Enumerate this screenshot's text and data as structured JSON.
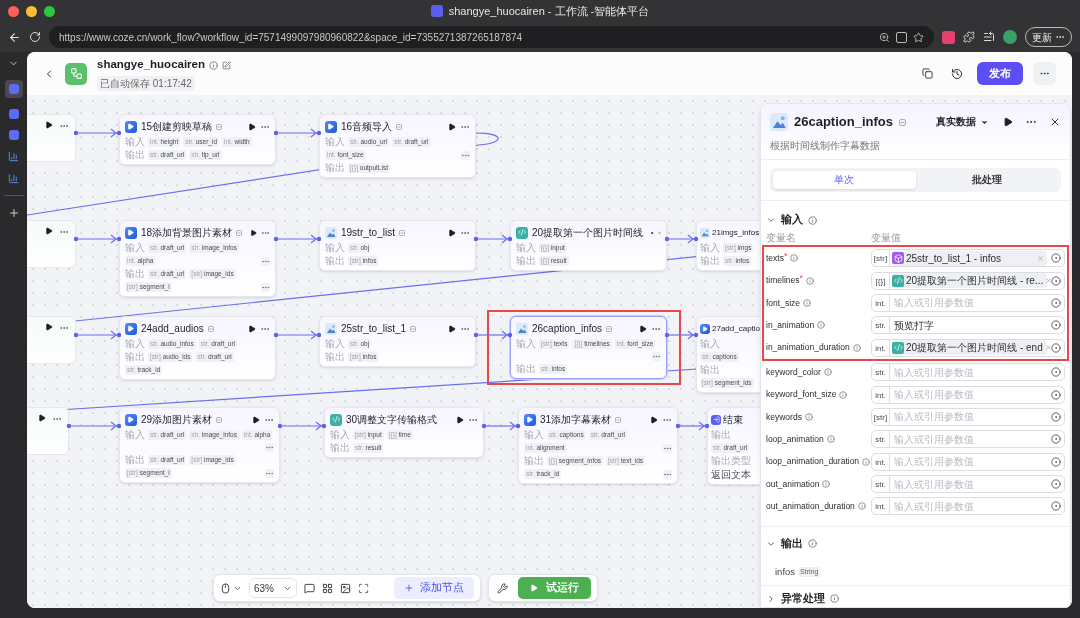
{
  "browser": {
    "tab_title": "shangye_huocairen - 工作流 -智能体平台",
    "url": "https://www.coze.cn/work_flow?workflow_id=7571499097980960822&space_id=7355271387265187874",
    "update_button": "更新"
  },
  "header": {
    "title": "shangye_huocairen",
    "autosave": "已自动保存 01:17:42",
    "publish_button": "发布"
  },
  "nodes": [
    {
      "title": "15创建剪映草稿",
      "kind": "clip",
      "plugin_mark": true,
      "selected": false,
      "highlighted": false,
      "rows": [
        {
          "label": "输入",
          "pins": [
            {
              "type": "int.",
              "name": "height"
            },
            {
              "type": "str.",
              "name": "user_id"
            },
            {
              "type": "int.",
              "name": "width"
            }
          ],
          "more": false
        },
        {
          "label": "输出",
          "pins": [
            {
              "type": "str.",
              "name": "draft_url"
            },
            {
              "type": "str.",
              "name": "tip_url"
            }
          ],
          "more": false
        }
      ]
    },
    {
      "title": "16音频导入",
      "kind": "clip",
      "plugin_mark": true,
      "selected": false,
      "highlighted": false,
      "rows": [
        {
          "label": "输入",
          "pins": [
            {
              "type": "str.",
              "name": "audio_url"
            },
            {
              "type": "str.",
              "name": "draft_url"
            },
            {
              "type": "int.",
              "name": "font_size"
            }
          ],
          "more": true
        },
        {
          "label": "输出",
          "pins": [
            {
              "type": "[{}]",
              "name": "outputList"
            }
          ],
          "more": false
        }
      ]
    },
    {
      "title": "18添加背景图片素材",
      "kind": "clip",
      "plugin_mark": true,
      "selected": false,
      "highlighted": false,
      "rows": [
        {
          "label": "输入",
          "pins": [
            {
              "type": "str.",
              "name": "draft_url"
            },
            {
              "type": "str.",
              "name": "image_infos"
            },
            {
              "type": "int.",
              "name": "alpha"
            }
          ],
          "more": true
        },
        {
          "label": "输出",
          "pins": [
            {
              "type": "str.",
              "name": "draft_url"
            },
            {
              "type": "[str]",
              "name": "image_ids"
            },
            {
              "type": "[str]",
              "name": "segment_i"
            }
          ],
          "more": true
        }
      ]
    },
    {
      "title": "19str_to_list",
      "kind": "picture",
      "plugin_mark": true,
      "selected": false,
      "highlighted": false,
      "rows": [
        {
          "label": "输入",
          "pins": [
            {
              "type": "str.",
              "name": "obj"
            }
          ],
          "more": false
        },
        {
          "label": "输出",
          "pins": [
            {
              "type": "[str]",
              "name": "infos"
            }
          ],
          "more": false
        }
      ]
    },
    {
      "title": "20提取第一个图片时间线",
      "kind": "code",
      "plugin_mark": false,
      "selected": false,
      "highlighted": false,
      "rows": [
        {
          "label": "输入",
          "pins": [
            {
              "type": "[{}]",
              "name": "input"
            }
          ],
          "more": false
        },
        {
          "label": "输出",
          "pins": [
            {
              "type": "[{}]",
              "name": "result"
            }
          ],
          "more": false
        }
      ]
    },
    {
      "title": "21imgs_infos",
      "kind": "picture",
      "plugin_mark": false,
      "selected": false,
      "highlighted": false,
      "rows": [
        {
          "label": "输入",
          "pins": [
            {
              "type": "[str]",
              "name": "imgs"
            }
          ],
          "more": false
        },
        {
          "label": "输出",
          "pins": [
            {
              "type": "str.",
              "name": "infos"
            }
          ],
          "more": false
        }
      ]
    },
    {
      "title": "24add_audios",
      "kind": "clip",
      "plugin_mark": true,
      "selected": false,
      "highlighted": false,
      "rows": [
        {
          "label": "输入",
          "pins": [
            {
              "type": "str.",
              "name": "audio_infos"
            },
            {
              "type": "str.",
              "name": "draft_url"
            }
          ],
          "more": false
        },
        {
          "label": "输出",
          "pins": [
            {
              "type": "[str]",
              "name": "audio_ids"
            },
            {
              "type": "str.",
              "name": "draft_url"
            },
            {
              "type": "str.",
              "name": "track_id"
            }
          ],
          "more": false
        }
      ]
    },
    {
      "title": "25str_to_list_1",
      "kind": "picture",
      "plugin_mark": true,
      "selected": false,
      "highlighted": false,
      "rows": [
        {
          "label": "输入",
          "pins": [
            {
              "type": "str.",
              "name": "obj"
            }
          ],
          "more": false
        },
        {
          "label": "输出",
          "pins": [
            {
              "type": "[str]",
              "name": "infos"
            }
          ],
          "more": false
        }
      ]
    },
    {
      "title": "26caption_infos",
      "kind": "picture",
      "plugin_mark": true,
      "selected": true,
      "highlighted": true,
      "rows": [
        {
          "label": "输入",
          "pins": [
            {
              "type": "[str]",
              "name": "texts"
            },
            {
              "type": "[{}]",
              "name": "timelines"
            },
            {
              "type": "int.",
              "name": "font_size"
            }
          ],
          "more": true
        },
        {
          "label": "输出",
          "pins": [
            {
              "type": "str.",
              "name": "infos"
            }
          ],
          "more": false
        }
      ]
    },
    {
      "title": "27add_captio",
      "kind": "clip",
      "plugin_mark": false,
      "selected": false,
      "highlighted": false,
      "rows": [
        {
          "label": "输入",
          "pins": [
            {
              "type": "str.",
              "name": "captions"
            }
          ],
          "more": false
        },
        {
          "label": "输出",
          "pins": [
            {
              "type": "[str]",
              "name": "segment_ids"
            }
          ],
          "more": false
        }
      ]
    },
    {
      "title": "29添加图片素材",
      "kind": "clip",
      "plugin_mark": true,
      "selected": false,
      "highlighted": false,
      "rows": [
        {
          "label": "输入",
          "pins": [
            {
              "type": "str.",
              "name": "draft_url"
            },
            {
              "type": "str.",
              "name": "image_infos"
            },
            {
              "type": "int.",
              "name": "alpha"
            }
          ],
          "more": true
        },
        {
          "label": "输出",
          "pins": [
            {
              "type": "str.",
              "name": "draft_url"
            },
            {
              "type": "[str]",
              "name": "image_ids"
            },
            {
              "type": "[str]",
              "name": "segment_i"
            }
          ],
          "more": true
        }
      ]
    },
    {
      "title": "30调整文字传输格式",
      "kind": "code",
      "plugin_mark": false,
      "selected": false,
      "highlighted": false,
      "rows": [
        {
          "label": "输入",
          "pins": [
            {
              "type": "[str]",
              "name": "input"
            },
            {
              "type": "[{}]",
              "name": "time"
            }
          ],
          "more": false
        },
        {
          "label": "输出",
          "pins": [
            {
              "type": "str.",
              "name": "result"
            }
          ],
          "more": false
        }
      ]
    },
    {
      "title": "31添加字幕素材",
      "kind": "clip",
      "plugin_mark": true,
      "selected": false,
      "highlighted": false,
      "rows": [
        {
          "label": "输入",
          "pins": [
            {
              "type": "str.",
              "name": "captions"
            },
            {
              "type": "str.",
              "name": "draft_url"
            },
            {
              "type": "int.",
              "name": "alignment"
            }
          ],
          "more": true
        },
        {
          "label": "输出",
          "pins": [
            {
              "type": "[{}]",
              "name": "segment_infos"
            },
            {
              "type": "[str]",
              "name": "text_ids"
            },
            {
              "type": "str.",
              "name": "track_id"
            }
          ],
          "more": true
        }
      ]
    },
    {
      "title": "结束",
      "kind": "end",
      "plugin_mark": false,
      "selected": false,
      "highlighted": false,
      "rows": [
        {
          "label": "输出",
          "pins": [
            {
              "type": "str.",
              "name": "draft_url"
            }
          ],
          "more": false
        },
        {
          "label": "输出类型",
          "value": "返回文本",
          "more": false
        }
      ]
    }
  ],
  "toolbar": {
    "zoom": "63%",
    "add_node_button": "添加节点",
    "run_button": "试运行"
  },
  "panel": {
    "title": "26caption_infos",
    "data_mode": "真实数据",
    "description": "根据时间线制作字幕数据",
    "tabs": [
      {
        "label": "单次",
        "selected": true
      },
      {
        "label": "批处理",
        "selected": false
      }
    ],
    "input_section": {
      "title": "输入",
      "expanded": true,
      "name_header": "变量名",
      "value_header": "变量值",
      "highlighted_params": [
        {
          "name": "texts",
          "required_mark": "*",
          "type": "[str]",
          "kind": "plugin_reference",
          "value": "25str_to_list_1 - infos"
        },
        {
          "name": "timelines",
          "required_mark": "*",
          "type": "[{}]",
          "kind": "code_reference",
          "value": "20提取第一个图片时间线 - re..."
        },
        {
          "name": "font_size",
          "type": "int.",
          "kind": "empty",
          "placeholder": "输入或引用参数值"
        },
        {
          "name": "in_animation",
          "type": "str.",
          "kind": "text",
          "value": "预览打字"
        },
        {
          "name": "in_animation_duration",
          "type": "int.",
          "kind": "code_reference",
          "value": "20提取第一个图片时间线 - end"
        }
      ],
      "params": [
        {
          "name": "keyword_color",
          "type": "str.",
          "kind": "empty",
          "placeholder": "输入或引用参数值"
        },
        {
          "name": "keyword_font_size",
          "type": "int.",
          "kind": "empty",
          "placeholder": "输入或引用参数值"
        },
        {
          "name": "keywords",
          "type": "[str]",
          "kind": "empty",
          "placeholder": "输入或引用参数值"
        },
        {
          "name": "loop_animation",
          "type": "str.",
          "kind": "empty",
          "placeholder": "输入或引用参数值"
        },
        {
          "name": "loop_animation_duration",
          "type": "int.",
          "kind": "empty",
          "placeholder": "输入或引用参数值"
        },
        {
          "name": "out_animation",
          "type": "str.",
          "kind": "empty",
          "placeholder": "输入或引用参数值"
        },
        {
          "name": "out_animation_duration",
          "type": "int.",
          "kind": "empty",
          "placeholder": "输入或引用参数值"
        }
      ]
    },
    "output_section": {
      "title": "输出",
      "expanded": true,
      "outputs": [
        {
          "name": "infos",
          "type": "String"
        }
      ]
    },
    "error_section": {
      "title": "异常处理",
      "expanded": false
    }
  }
}
